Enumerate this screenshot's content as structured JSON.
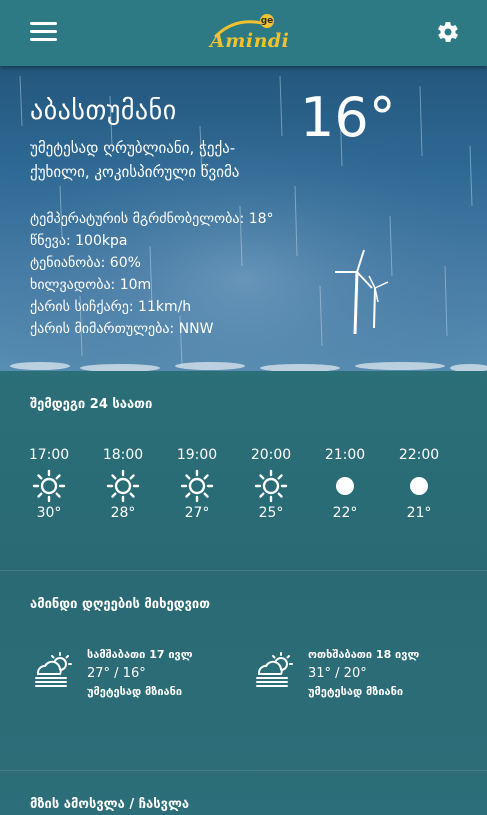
{
  "header": {
    "logo_text": "Amindi",
    "logo_badge": "ge"
  },
  "current": {
    "city": "აბასთუმანი",
    "temperature": "16°",
    "condition": "უმეტესად ღრუბლიანი, ჭექა-ქუხილი, კოკისპირული წვიმა",
    "details": [
      {
        "label": "ტემპერატურის მგრძნობელობა:",
        "value": "18°"
      },
      {
        "label": "წნევა:",
        "value": "100kpa"
      },
      {
        "label": "ტენიანობა:",
        "value": "60%"
      },
      {
        "label": "ხილვადობა:",
        "value": "10m"
      },
      {
        "label": "ქარის სიჩქარე:",
        "value": "11km/h"
      },
      {
        "label": "ქარის მიმართულება:",
        "value": "NNW"
      }
    ]
  },
  "hourly": {
    "title": "შემდეგი 24 საათი",
    "items": [
      {
        "time": "17:00",
        "icon": "sun-icon",
        "temp": "30°"
      },
      {
        "time": "18:00",
        "icon": "sun-icon",
        "temp": "28°"
      },
      {
        "time": "19:00",
        "icon": "sun-icon",
        "temp": "27°"
      },
      {
        "time": "20:00",
        "icon": "sun-icon",
        "temp": "25°"
      },
      {
        "time": "21:00",
        "icon": "moon-icon",
        "temp": "22°"
      },
      {
        "time": "22:00",
        "icon": "moon-icon",
        "temp": "21°"
      }
    ]
  },
  "daily": {
    "title": "ამინდი დღეების მიხედვით",
    "items": [
      {
        "date": "სამშაბათი 17 ივლ",
        "temps": "27° / 16°",
        "desc": "უმეტესად მზიანი",
        "icon": "partly-sunny-haze-icon"
      },
      {
        "date": "ოთხშაბათი 18 ივლ",
        "temps": "31° / 20°",
        "desc": "უმეტესად მზიანი",
        "icon": "partly-sunny-haze-icon"
      }
    ]
  },
  "sun": {
    "title": "მზის ამოსვლა / ჩასვლა"
  },
  "colors": {
    "accent": "#f0c230",
    "header_bg": "#2d7a84",
    "background": "#2b6f79"
  }
}
